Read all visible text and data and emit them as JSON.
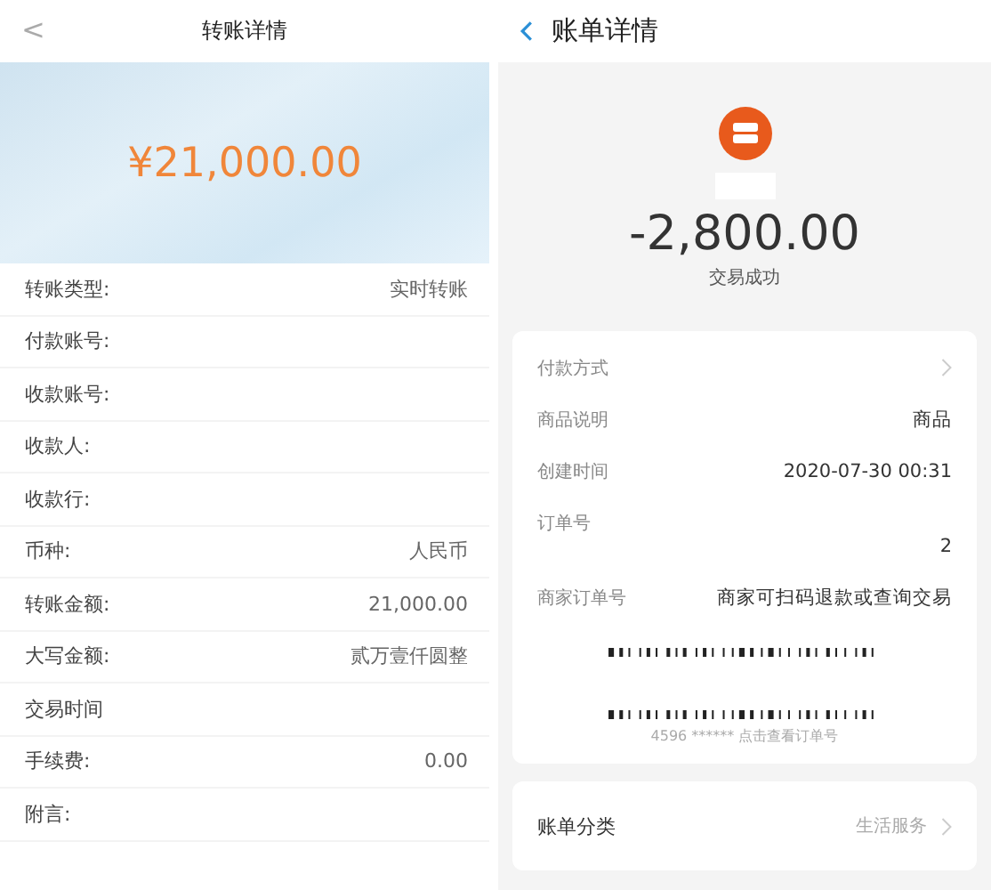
{
  "left_screen": {
    "back": "<",
    "title": "转账详情",
    "amount": "¥21,000.00",
    "rows": [
      {
        "label": "转账类型:",
        "value": "实时转账"
      },
      {
        "label": "付款账号:"
      },
      {
        "label": "收款账号:"
      },
      {
        "label": "收款人:"
      },
      {
        "label": "收款行:"
      },
      {
        "label": "币种:",
        "value": "人民币"
      },
      {
        "label": "转账金额:",
        "value": "21,000.00"
      },
      {
        "label": "大写金额:",
        "value": "贰万壹仟圆整"
      },
      {
        "label": "交易时间"
      },
      {
        "label": "手续费:",
        "value": "0.00"
      },
      {
        "label": "附言:"
      }
    ]
  },
  "right_screen": {
    "title": "账单详情",
    "amount": "-2,800.00",
    "status": "交易成功",
    "details": [
      {
        "kind": "link",
        "label": "付款方式"
      },
      {
        "kind": "plain",
        "label": "商品说明",
        "value": "商品"
      },
      {
        "kind": "plain",
        "label": "创建时间",
        "value": "2020-07-30 00:31"
      },
      {
        "kind": "stacked",
        "label": "订单号",
        "value": "2"
      },
      {
        "kind": "plain",
        "label": "商家订单号",
        "value": "商家可扫码退款或查询交易"
      }
    ],
    "order_hint": "4596 ****** 点击查看订单号",
    "category": {
      "label": "账单分类",
      "value": "生活服务"
    }
  }
}
